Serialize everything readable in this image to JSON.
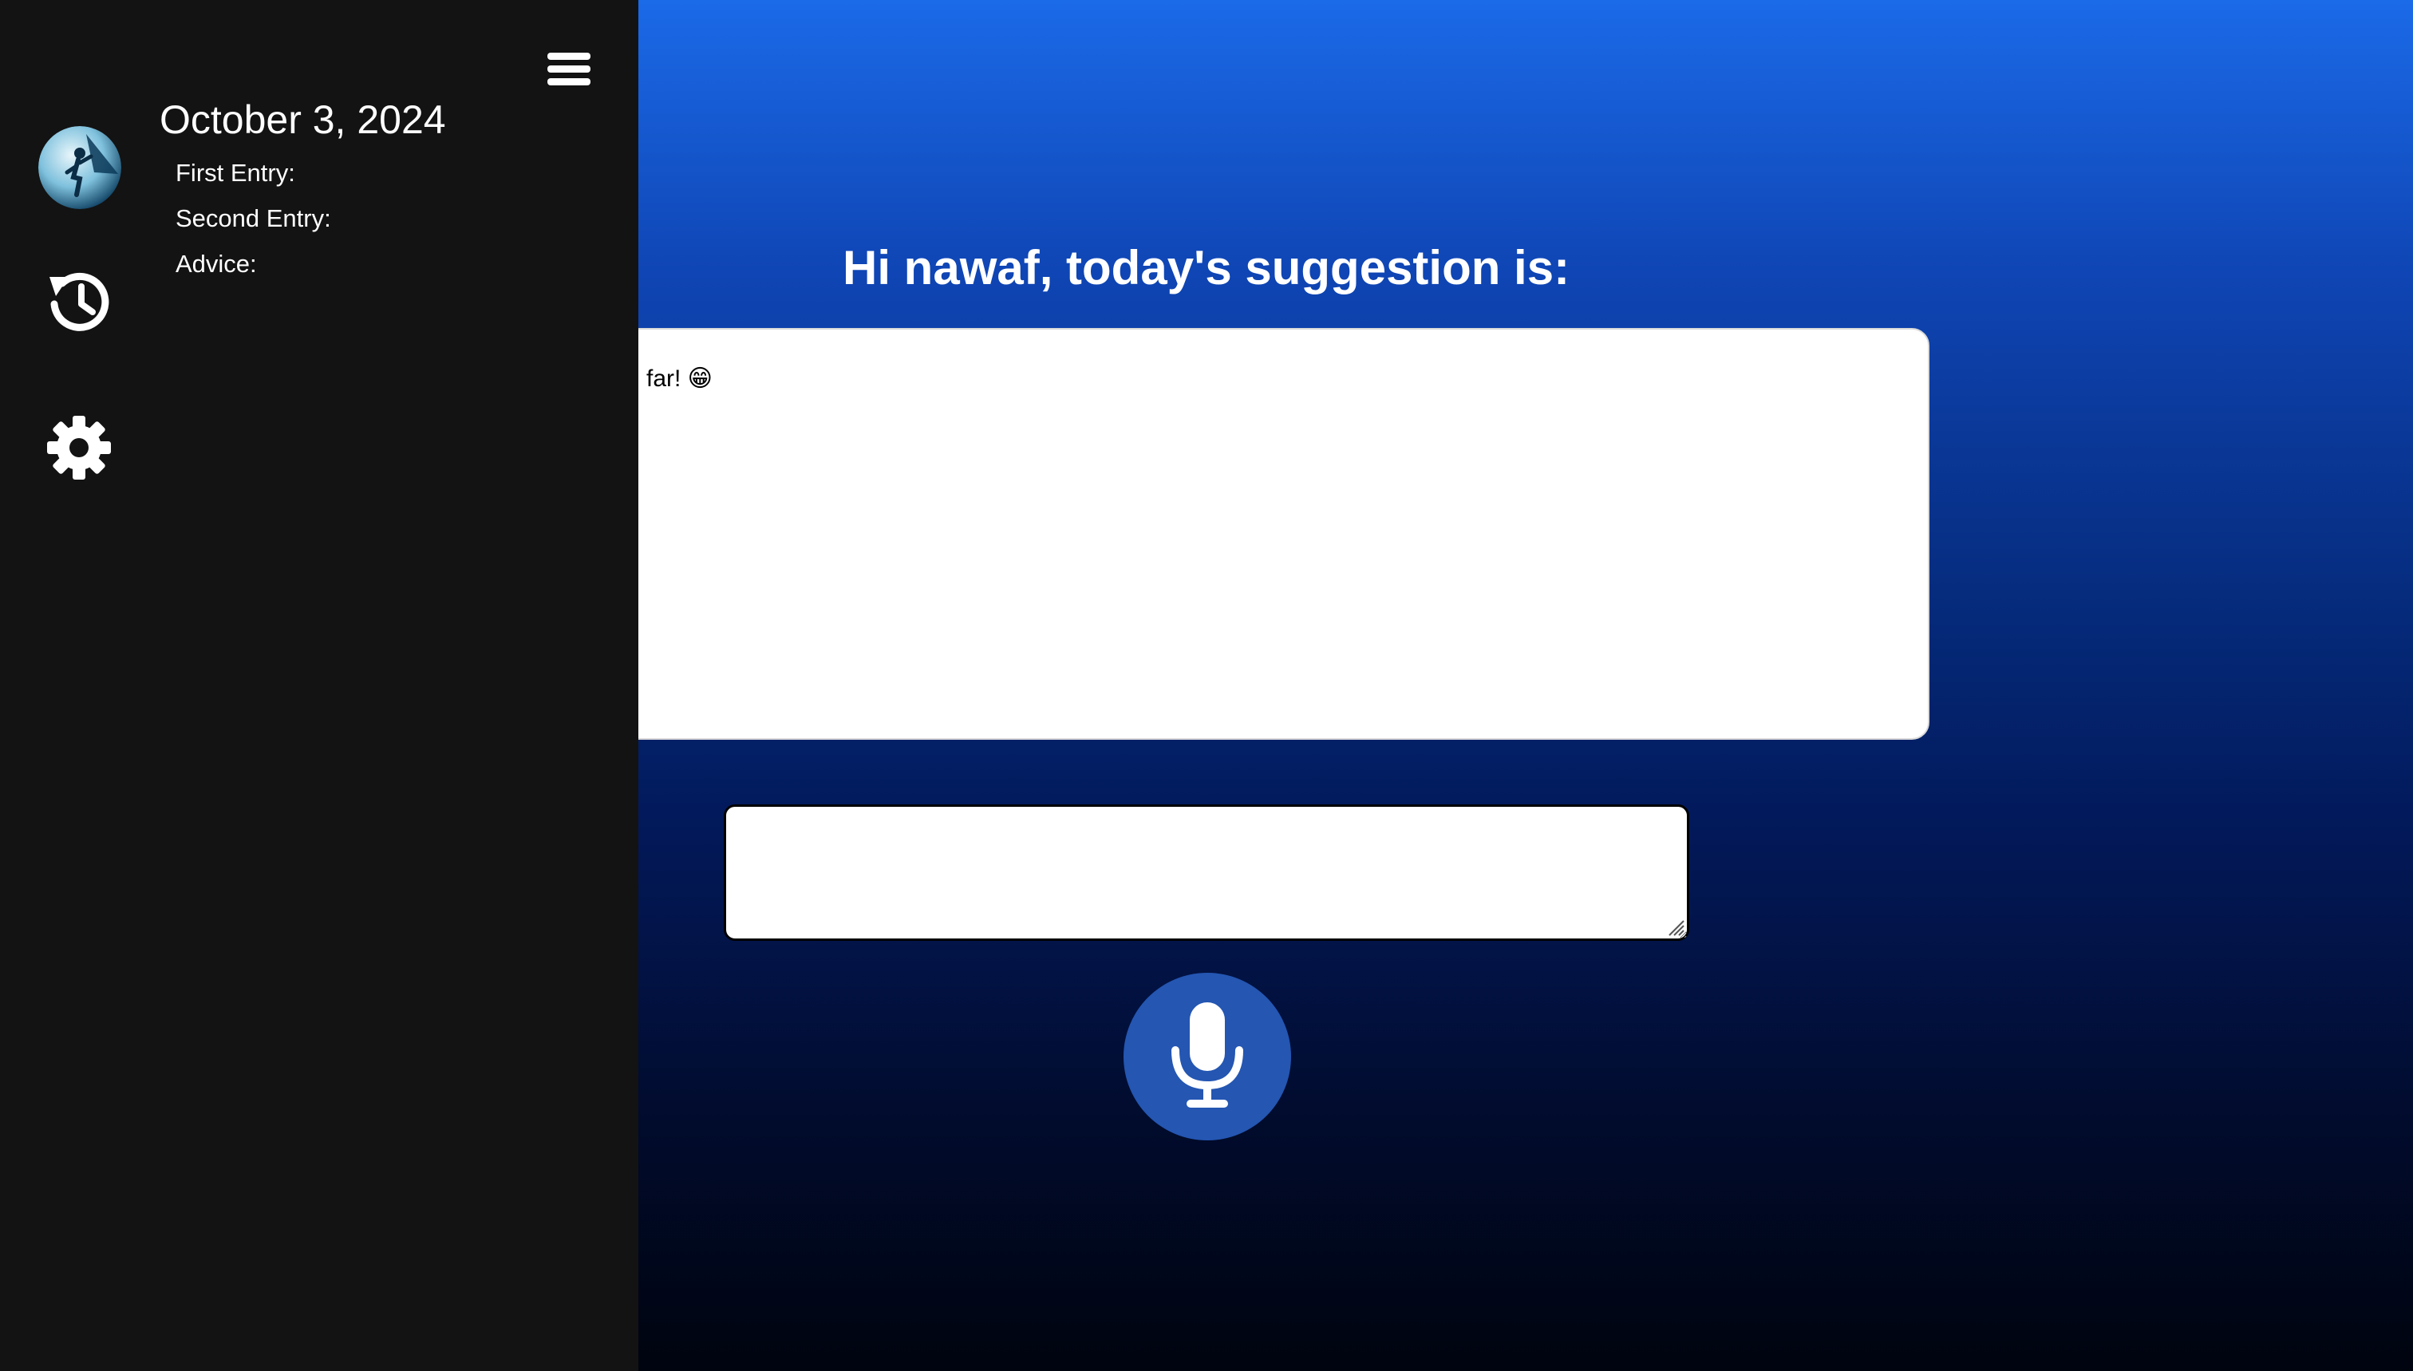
{
  "main": {
    "greeting": "Hi nawaf, today's suggestion is:",
    "suggestion_visible_text": "far! 😁",
    "entry_input_value": "",
    "entry_input_placeholder": ""
  },
  "sidebar": {
    "menu_icon": "hamburger-menu-icon",
    "avatar_icon": "climber-avatar",
    "history_icon": "history-icon",
    "settings_icon": "gear-icon",
    "entry": {
      "date": "October 3, 2024",
      "first_entry_label": "First Entry:",
      "second_entry_label": "Second Entry:",
      "advice_label": "Advice:"
    }
  },
  "mic": {
    "icon": "microphone-icon"
  },
  "colors": {
    "background_top": "#1b6ae8",
    "background_bottom": "#00040f",
    "sidebar": "#131313",
    "mic_button": "#2456b2"
  }
}
